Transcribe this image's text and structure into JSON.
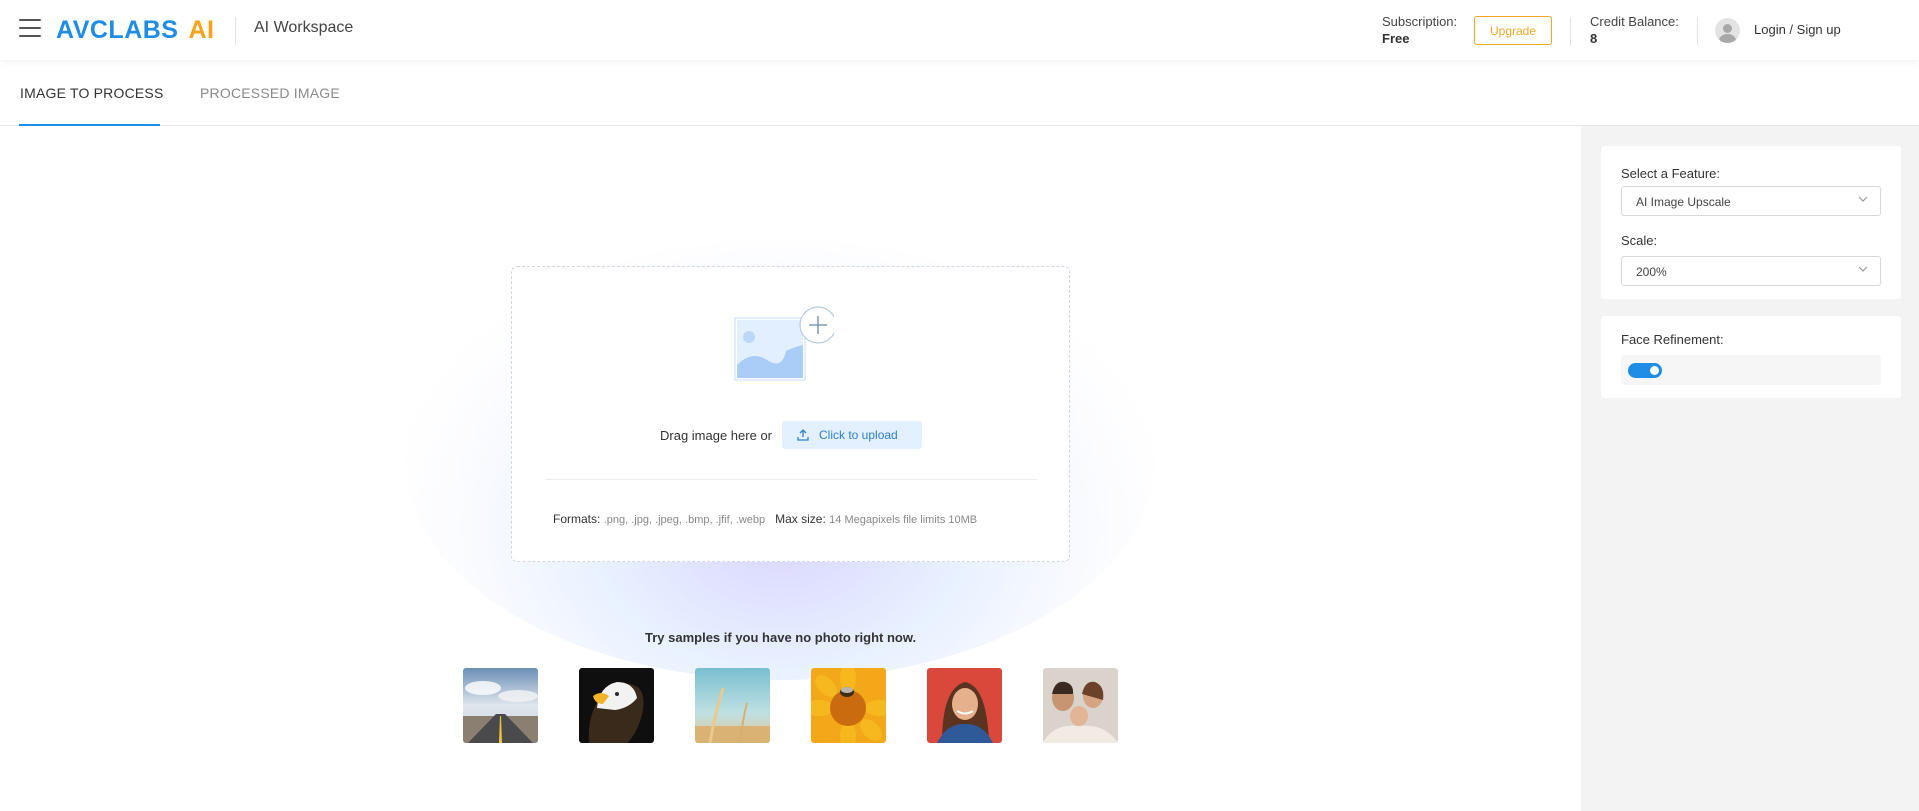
{
  "header": {
    "logo_brand": "AVCLABS",
    "logo_ai": "AI",
    "workspace": "AI Workspace",
    "subscription_label": "Subscription:",
    "subscription_value": "Free",
    "upgrade_label": "Upgrade",
    "credit_label": "Credit Balance:",
    "credit_value": "8",
    "login_label": "Login / Sign up"
  },
  "tabs": [
    {
      "label": "IMAGE TO PROCESS",
      "active": true
    },
    {
      "label": "PROCESSED IMAGE",
      "active": false
    }
  ],
  "upload": {
    "drag_text": "Drag image here or",
    "button_label": "Click to upload",
    "formats_label": "Formats:",
    "formats_value": ".png, .jpg, .jpeg, .bmp, .jfif, .webp",
    "maxsize_label": "Max size:",
    "maxsize_value": "14 Megapixels file limits 10MB"
  },
  "samples": {
    "title": "Try samples if you have no photo right now.",
    "items": [
      "road-sample",
      "eagle-sample",
      "wheat-sample",
      "bee-flower-sample",
      "woman-sample",
      "family-sample"
    ]
  },
  "settings": {
    "feature_label": "Select a Feature:",
    "feature_value": "AI Image Upscale",
    "scale_label": "Scale:",
    "scale_value": "200%",
    "face_label": "Face Refinement:",
    "face_enabled": true
  },
  "colors": {
    "accent": "#1f8de6",
    "brand_orange": "#f5a31a",
    "upgrade": "#f0a826",
    "side_bg": "#f3f3f3"
  }
}
